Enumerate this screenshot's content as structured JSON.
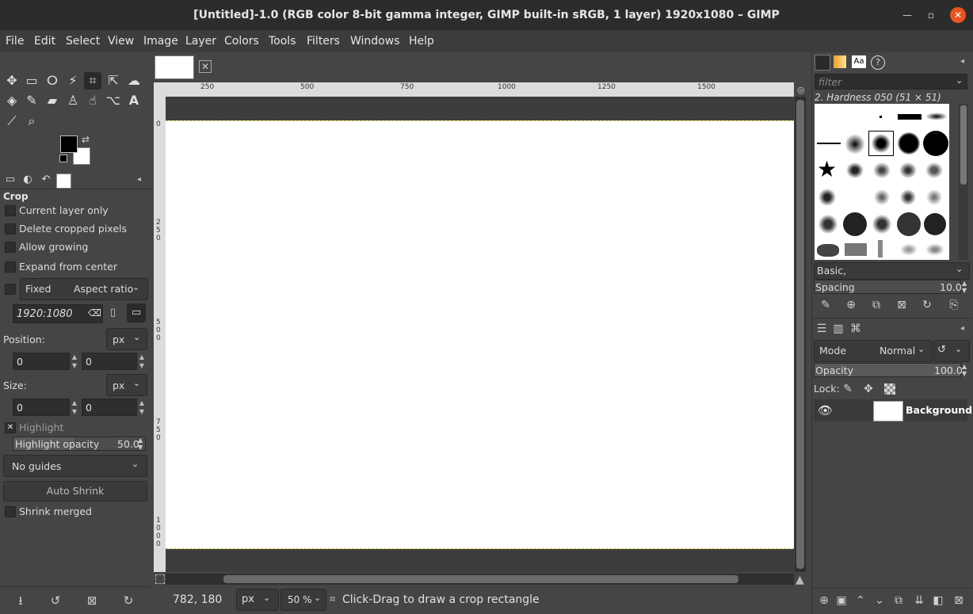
{
  "window": {
    "title": "[Untitled]-1.0 (RGB color 8-bit gamma integer, GIMP built-in sRGB, 1 layer) 1920x1080 – GIMP",
    "minimize": "—",
    "maximize": "▫",
    "close": "✕"
  },
  "menu": [
    "File",
    "Edit",
    "Select",
    "View",
    "Image",
    "Layer",
    "Colors",
    "Tools",
    "Filters",
    "Windows",
    "Help"
  ],
  "toolbox": {
    "tools": [
      {
        "name": "move-tool-icon",
        "glyph": "✥"
      },
      {
        "name": "rect-select-icon",
        "glyph": "▭"
      },
      {
        "name": "lasso-icon",
        "glyph": "ⵔ"
      },
      {
        "name": "fuzzy-select-icon",
        "glyph": "⚡"
      },
      {
        "name": "crop-tool-icon",
        "glyph": "⌗"
      },
      {
        "name": "transform-icon",
        "glyph": "⇱"
      },
      {
        "name": "warp-icon",
        "glyph": "☁"
      },
      {
        "name": "bucket-fill-icon",
        "glyph": "◈"
      },
      {
        "name": "paintbrush-icon",
        "glyph": "✎"
      },
      {
        "name": "eraser-icon",
        "glyph": "▰"
      },
      {
        "name": "clone-icon",
        "glyph": "♙"
      },
      {
        "name": "smudge-icon",
        "glyph": "☝"
      },
      {
        "name": "paths-icon",
        "glyph": "⌥"
      },
      {
        "name": "text-tool-icon",
        "glyph": "A"
      },
      {
        "name": "color-picker-icon",
        "glyph": "⟋"
      },
      {
        "name": "zoom-icon",
        "glyph": "⌕"
      }
    ],
    "swap_glyph": "⇄"
  },
  "tool_options": {
    "title": "Crop",
    "current_layer_only": "Current layer only",
    "delete_cropped": "Delete cropped pixels",
    "allow_growing": "Allow growing",
    "expand_from_center": "Expand from center",
    "fixed_label": "Fixed",
    "fixed_mode": "Aspect ratio",
    "ratio_value": "1920:1080",
    "position_label": "Position:",
    "position_unit": "px",
    "position_x": "0",
    "position_y": "0",
    "size_label": "Size:",
    "size_unit": "px",
    "size_w": "0",
    "size_h": "0",
    "highlight_label": "Highlight",
    "highlight_opacity_label": "Highlight opacity",
    "highlight_opacity_value": "50.0",
    "guides_value": "No guides",
    "auto_shrink": "Auto Shrink",
    "shrink_merged": "Shrink merged"
  },
  "canvas": {
    "ruler_top": [
      "250",
      "500",
      "750",
      "1000",
      "1250",
      "1500"
    ],
    "ruler_left": [
      "0",
      "250",
      "500",
      "750",
      "1000"
    ],
    "status_coords": "782, 180",
    "status_unit": "px",
    "status_zoom": "50 %",
    "status_message": "Click-Drag to draw a crop rectangle"
  },
  "brushes": {
    "filter_placeholder": "filter",
    "current_brush": "2. Hardness 050 (51 × 51)",
    "preset": "Basic,",
    "spacing_label": "Spacing",
    "spacing_value": "10.0"
  },
  "layers": {
    "mode_label": "Mode",
    "mode_value": "Normal",
    "opacity_label": "Opacity",
    "opacity_value": "100.0",
    "lock_label": "Lock:",
    "layer_name": "Background"
  }
}
